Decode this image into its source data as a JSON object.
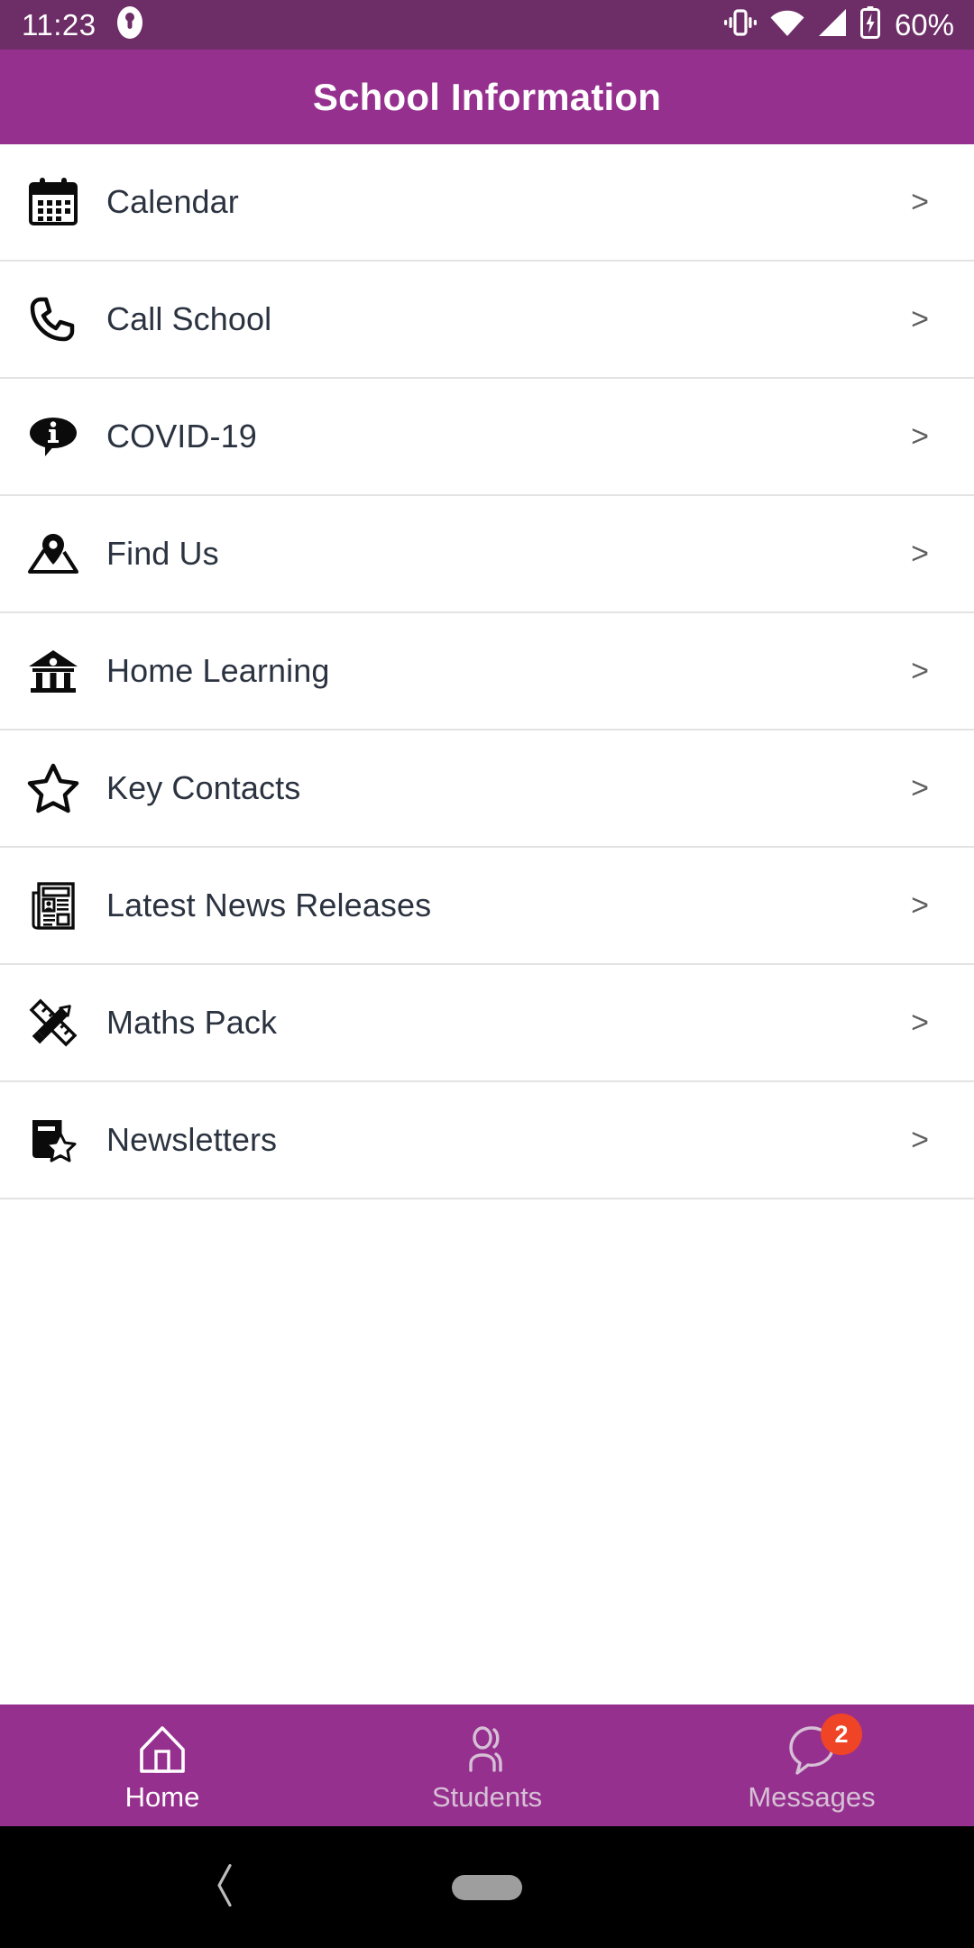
{
  "status_bar": {
    "time": "11:23",
    "battery_percent": "60%",
    "icons": [
      "notification-dot-icon",
      "vibrate-icon",
      "wifi-icon",
      "cellular-signal-icon",
      "battery-charging-icon"
    ]
  },
  "app_bar": {
    "title": "School Information"
  },
  "list": {
    "chevron": ">",
    "items": [
      {
        "label": "Calendar",
        "icon": "calendar-icon"
      },
      {
        "label": "Call School",
        "icon": "phone-icon"
      },
      {
        "label": "COVID-19",
        "icon": "info-bubble-icon"
      },
      {
        "label": "Find Us",
        "icon": "map-pin-icon"
      },
      {
        "label": "Home Learning",
        "icon": "bank-building-icon"
      },
      {
        "label": "Key Contacts",
        "icon": "star-outline-icon"
      },
      {
        "label": "Latest News Releases",
        "icon": "newspaper-icon"
      },
      {
        "label": "Maths Pack",
        "icon": "ruler-pencil-icon"
      },
      {
        "label": "Newsletters",
        "icon": "book-star-icon"
      }
    ]
  },
  "bottom_nav": {
    "tabs": [
      {
        "label": "Home",
        "icon": "home-icon",
        "active": true,
        "badge": ""
      },
      {
        "label": "Students",
        "icon": "students-icon",
        "active": false,
        "badge": ""
      },
      {
        "label": "Messages",
        "icon": "message-icon",
        "active": false,
        "badge": "2"
      }
    ]
  },
  "system_nav": {
    "back": "back-chevron-icon",
    "home_pill": "home-pill-indicator"
  },
  "colors": {
    "status_bar": "#6d2d66",
    "app_bar": "#96308f",
    "bottom_nav": "#96308f",
    "badge": "#f04426",
    "row_text": "#2b3340",
    "divider": "#e3e3e5"
  }
}
